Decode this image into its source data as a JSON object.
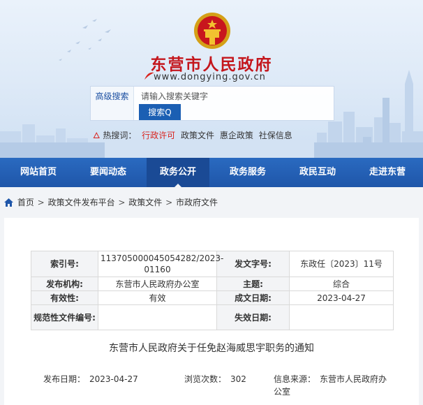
{
  "site": {
    "title": "东营市人民政府",
    "url": "www.dongying.gov.cn"
  },
  "search": {
    "advanced_label": "高级搜索",
    "placeholder": "请输入搜索关键字",
    "button_label": "搜索Q"
  },
  "hotwords": {
    "label": "热搜词：",
    "items": [
      "行政许可",
      "政策文件",
      "惠企政策",
      "社保信息"
    ]
  },
  "nav": {
    "items": [
      "网站首页",
      "要闻动态",
      "政务公开",
      "政务服务",
      "政民互动",
      "走进东营"
    ],
    "active_index": 2
  },
  "breadcrumb": {
    "items": [
      "首页",
      "政策文件发布平台",
      "政策文件",
      "市政府文件"
    ],
    "separator": ">"
  },
  "meta": {
    "index_label": "索引号:",
    "index_value": "113705000045054282/2023-01160",
    "docno_label": "发文字号:",
    "docno_value": "东政任〔2023〕11号",
    "issuer_label": "发布机构:",
    "issuer_value": "东营市人民政府办公室",
    "topic_label": "主题:",
    "topic_value": "综合",
    "validity_label": "有效性:",
    "validity_value": "有效",
    "written_label": "成文日期:",
    "written_value": "2023-04-27",
    "norm_label": "规范性文件编号:",
    "norm_value": "",
    "expire_label": "失效日期:",
    "expire_value": ""
  },
  "document": {
    "title": "东营市人民政府关于任免赵海威思宇职务的通知",
    "publish_label": "发布日期：",
    "publish_date": "2023-04-27",
    "views_label": "浏览次数：",
    "views": "302",
    "source_label": "信息来源：",
    "source": "东营市人民政府办公室"
  },
  "colors": {
    "brand_red": "#c4161c",
    "nav_blue": "#1f56a9",
    "nav_active": "#1a4a95",
    "button_blue": "#1b5fb3"
  },
  "icons": [
    "national-emblem-icon",
    "fire-icon",
    "home-icon",
    "search-icon"
  ]
}
